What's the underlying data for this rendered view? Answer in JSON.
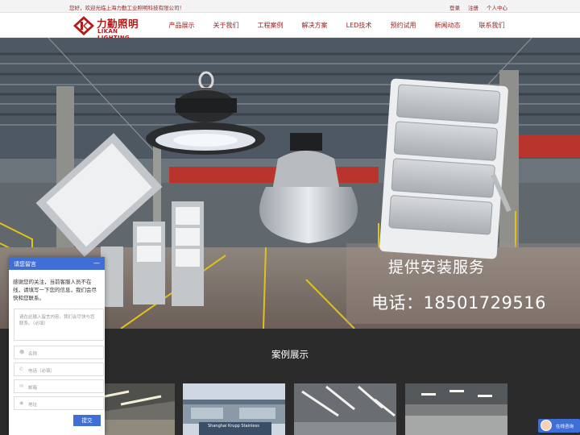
{
  "topbar": {
    "welcome": "您好，欢迎光临上海力勤工业照明科技有限公司！",
    "login": "登录",
    "register": "注册",
    "user_center": "个人中心"
  },
  "logo": {
    "cn": "力勤照明",
    "en": "LIKAN LIGHTING"
  },
  "nav": [
    {
      "label": "产品展示"
    },
    {
      "label": "关于我们"
    },
    {
      "label": "工程案例"
    },
    {
      "label": "解决方案"
    },
    {
      "label": "LED技术"
    },
    {
      "label": "预约试用"
    },
    {
      "label": "新闻动态"
    },
    {
      "label": "联系我们"
    }
  ],
  "banner": {
    "line1": "提供安装服务",
    "line2": "电话：18501729516"
  },
  "cases": {
    "title": "案例展示",
    "thumb_text": "Shanghai Krupp Stainless"
  },
  "chat": {
    "title": "请您留言",
    "minimize": "—",
    "message": "感谢您的关注，当前客服人员不在线，请填写一下您的信息，我们会尽快和您联系。",
    "textarea_placeholder": "请在此输入留言内容，我们会尽快与您联系。（必填）",
    "name_placeholder": "名称",
    "phone_placeholder": "电话（必填）",
    "email_placeholder": "邮箱",
    "address_placeholder": "地址",
    "submit": "提交"
  },
  "online_chat": {
    "label": "在线咨询"
  },
  "colors": {
    "brand_red": "#b31b1b",
    "chat_blue": "#3f6fd6",
    "cases_bg": "#2b2b2b"
  }
}
